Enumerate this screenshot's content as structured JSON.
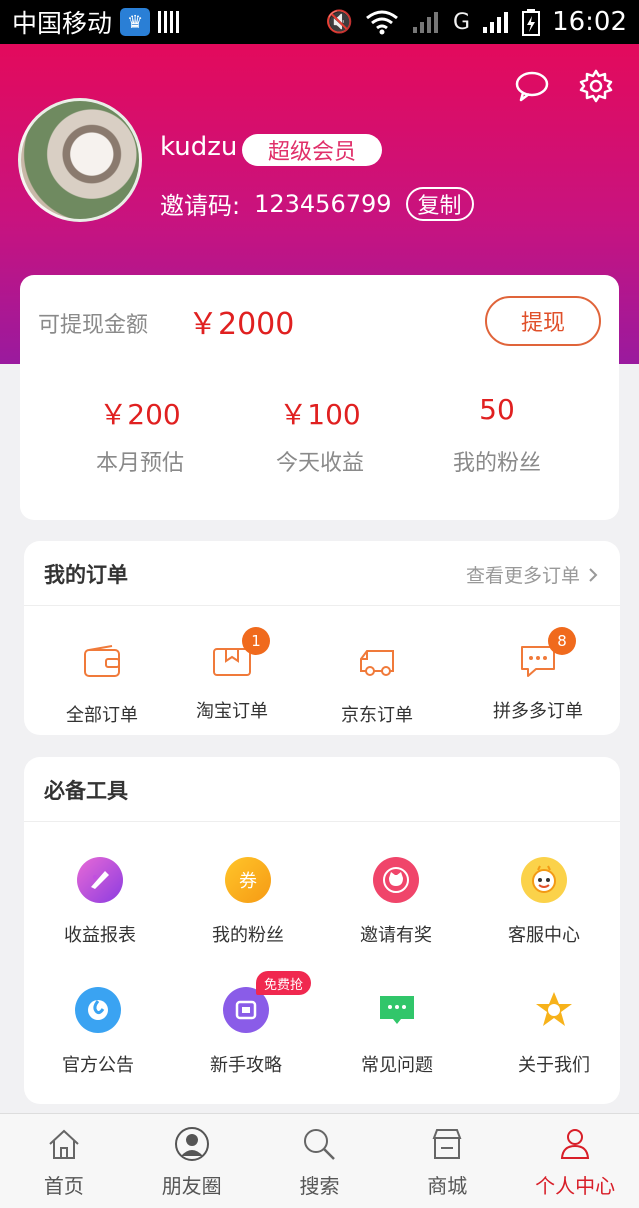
{
  "status_bar": {
    "carrier": "中国移动",
    "network": "G",
    "time": "16:02"
  },
  "profile": {
    "username": "kudzu",
    "vip_label": "超级会员",
    "invite_label": "邀请码:",
    "invite_code": "123456799",
    "copy_label": "复制",
    "icons": [
      "message-icon",
      "settings-icon"
    ]
  },
  "earnings": {
    "withdrawable_label": "可提现金额",
    "withdrawable_amount": "￥2000",
    "withdraw_button": "提现",
    "stats": [
      {
        "value": "￥200",
        "label": "本月预估"
      },
      {
        "value": "￥100",
        "label": "今天收益"
      },
      {
        "value": "50",
        "label": "我的粉丝"
      }
    ]
  },
  "orders": {
    "title": "我的订单",
    "more_label": "查看更多订单",
    "items": [
      {
        "label": "全部订单",
        "icon": "wallet-icon",
        "badge": ""
      },
      {
        "label": "淘宝订单",
        "icon": "taobao-box-icon",
        "badge": "1"
      },
      {
        "label": "京东订单",
        "icon": "truck-icon",
        "badge": ""
      },
      {
        "label": "拼多多订单",
        "icon": "chat-bubble-icon",
        "badge": "8"
      }
    ]
  },
  "tools": {
    "title": "必备工具",
    "free_tag": "免费抢",
    "items": [
      {
        "label": "收益报表",
        "icon": "palette-icon",
        "color": "#b04ad8"
      },
      {
        "label": "我的粉丝",
        "icon": "coupon-icon",
        "color": "#f7a81c",
        "glyph": "券"
      },
      {
        "label": "邀请有奖",
        "icon": "cat-face-icon",
        "color": "#f0456a"
      },
      {
        "label": "客服中心",
        "icon": "bee-icon",
        "color": "#f7a81c"
      },
      {
        "label": "官方公告",
        "icon": "notice-icon",
        "color": "#3a9ff2"
      },
      {
        "label": "新手攻略",
        "icon": "guide-icon",
        "color": "#8a5ce8"
      },
      {
        "label": "常见问题",
        "icon": "faq-chat-icon",
        "color": "#31c66a"
      },
      {
        "label": "关于我们",
        "icon": "star-burst-icon",
        "color": "#f2b21a"
      }
    ]
  },
  "nav": {
    "items": [
      {
        "label": "首页",
        "icon": "home-icon"
      },
      {
        "label": "朋友圈",
        "icon": "avatar-circle-icon"
      },
      {
        "label": "搜索",
        "icon": "search-icon"
      },
      {
        "label": "商城",
        "icon": "store-icon"
      },
      {
        "label": "个人中心",
        "icon": "person-icon"
      }
    ],
    "active_color": "#d81e28"
  }
}
